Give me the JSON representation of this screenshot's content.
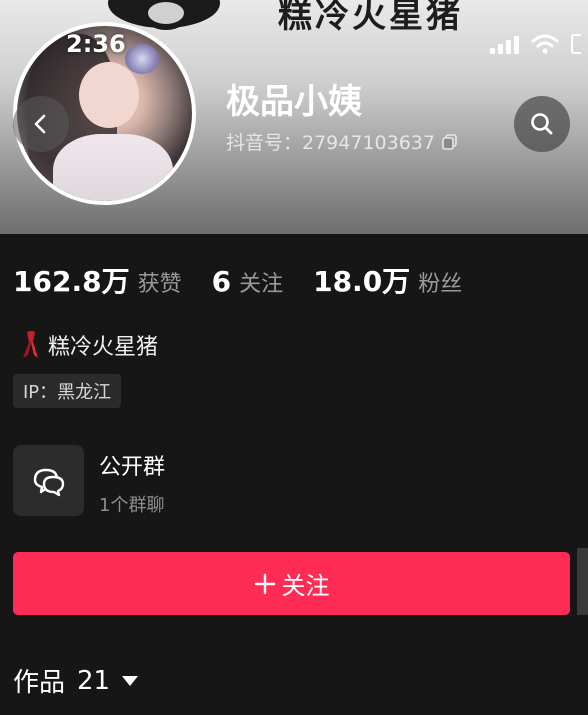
{
  "banner": {
    "text": "糕冷火星猪"
  },
  "status_bar": {
    "time": "2:36"
  },
  "profile": {
    "name": "极品小姨",
    "douyin_id": "抖音号：27947103637"
  },
  "stats": [
    {
      "value": "162.8万",
      "label": "获赞"
    },
    {
      "value": "6",
      "label": "关注"
    },
    {
      "value": "18.0万",
      "label": "粉丝"
    }
  ],
  "bio": {
    "text": "糕冷火星猪",
    "icon": "ribbon-icon"
  },
  "ip": {
    "label": "IP：黑龙江"
  },
  "group": {
    "title": "公开群",
    "subtitle": "1个群聊"
  },
  "follow_button": {
    "label": "关注"
  },
  "works": {
    "label": "作品",
    "count": "21"
  },
  "colors": {
    "accent": "#fe2c55",
    "background": "#161616"
  }
}
